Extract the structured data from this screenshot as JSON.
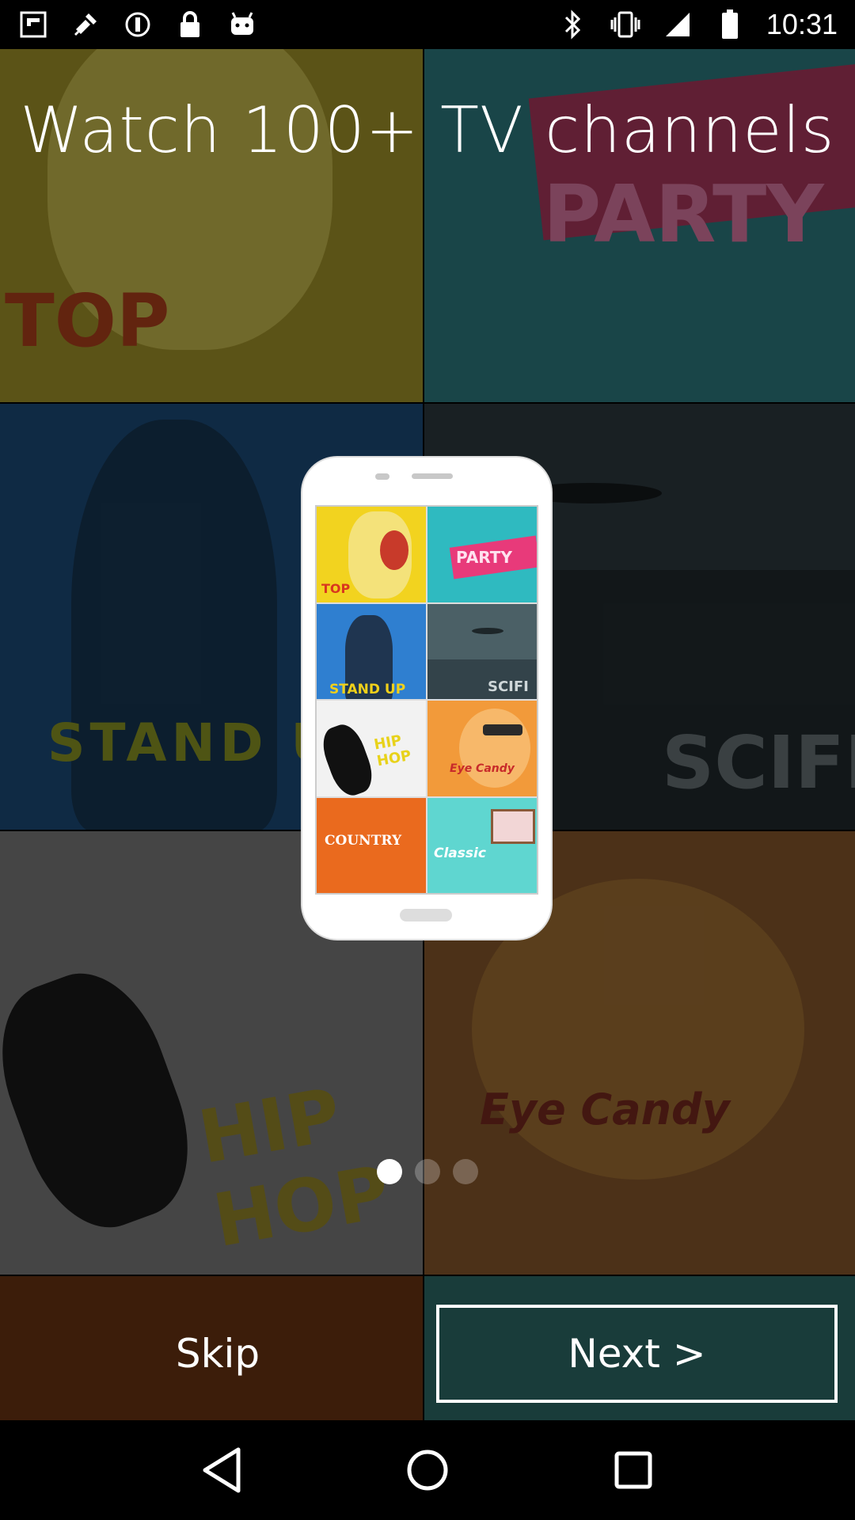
{
  "status_bar": {
    "time": "10:31",
    "left_icons": [
      "flipboard-icon",
      "satellite-icon",
      "sync-icon",
      "lock-icon",
      "android-icon"
    ],
    "right_icons": [
      "bluetooth-icon",
      "vibrate-icon",
      "signal-icon",
      "battery-icon"
    ]
  },
  "onboarding": {
    "title": "Watch 100+ TV channels",
    "background_tiles": [
      {
        "name": "top",
        "label": "TOP",
        "color": "#d9c43b"
      },
      {
        "name": "party",
        "label": "PARTY",
        "color": "#2aa8a3"
      },
      {
        "name": "stand-up",
        "label": "STAND U",
        "color": "#1f5f9f"
      },
      {
        "name": "scifi",
        "label": "SCIFI",
        "color": "#3b4a52"
      },
      {
        "name": "hip-hop",
        "label": "HIP HOP",
        "color": "#cfcfcf"
      },
      {
        "name": "eye-candy",
        "label": "Eye Candy",
        "color": "#c77a3a"
      },
      {
        "name": "country",
        "label": "",
        "color": "#b55a1f"
      },
      {
        "name": "classic",
        "label": "",
        "color": "#3fc7bf"
      }
    ],
    "phone_tiles": [
      {
        "name": "top",
        "label": "TOP",
        "color": "#f2d31f",
        "text_color": "#d9371f"
      },
      {
        "name": "party",
        "label": "PARTY",
        "color": "#2fbac0",
        "text_color": "#e83a7a"
      },
      {
        "name": "stand-up",
        "label": "STAND UP",
        "color": "#2f7fd0",
        "text_color": "#f0d01a"
      },
      {
        "name": "scifi",
        "label": "SCIFI",
        "color": "#4b6066",
        "text_color": "#cfd7d9"
      },
      {
        "name": "hip-hop",
        "label": "HIP HOP",
        "color": "#f2f2f2",
        "text_color": "#e8d21a"
      },
      {
        "name": "eye-candy",
        "label": "Eye Candy",
        "color": "#f29a3a",
        "text_color": "#c82a2a"
      },
      {
        "name": "country",
        "label": "COUNTRY",
        "color": "#ea6a1e",
        "text_color": "#ffffff"
      },
      {
        "name": "classic",
        "label": "Classic",
        "color": "#5fd6d0",
        "text_color": "#ffffff"
      }
    ],
    "page_indicator": {
      "total": 3,
      "current": 1
    },
    "skip_label": "Skip",
    "next_label": "Next >"
  },
  "nav_bar": {
    "back_icon": "back-triangle-icon",
    "home_icon": "home-circle-icon",
    "recents_icon": "recents-square-icon"
  }
}
